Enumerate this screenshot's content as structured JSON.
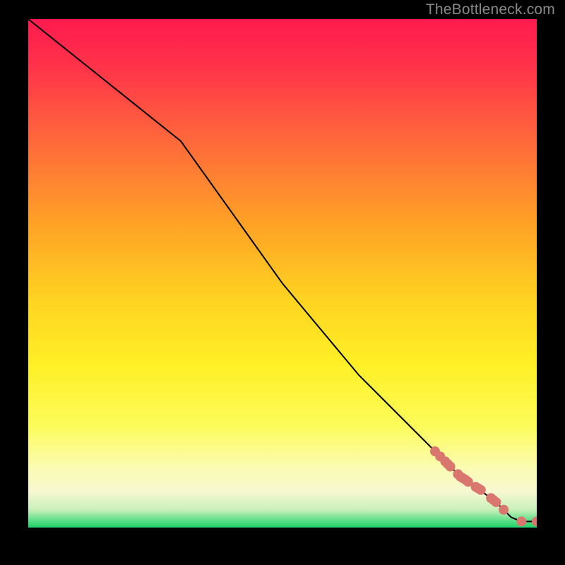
{
  "watermark": "TheBottleneck.com",
  "chart_data": {
    "type": "line",
    "title": "",
    "xlabel": "",
    "ylabel": "",
    "xlim": [
      0,
      100
    ],
    "ylim": [
      0,
      100
    ],
    "line": {
      "x": [
        0,
        5,
        10,
        15,
        20,
        25,
        30,
        35,
        40,
        45,
        50,
        55,
        60,
        65,
        70,
        75,
        80,
        82,
        84,
        86,
        88,
        90,
        92,
        93.5,
        95,
        97,
        100
      ],
      "y": [
        100,
        96,
        92,
        88,
        84,
        80,
        76,
        69,
        62,
        55,
        48,
        42,
        36,
        30,
        25,
        20,
        15,
        13,
        11,
        9.5,
        8,
        6.5,
        5,
        3.5,
        2,
        1.2,
        1.2
      ]
    },
    "markers": {
      "x": [
        80,
        81,
        82,
        82.5,
        83,
        84.5,
        85,
        85.5,
        86,
        86.5,
        88,
        88.5,
        89,
        91,
        91.5,
        92,
        93.5,
        97,
        100
      ],
      "y": [
        15,
        14,
        13,
        12.5,
        12,
        10.5,
        10,
        9.7,
        9.4,
        9,
        8,
        7.7,
        7.4,
        5.8,
        5.4,
        5,
        3.5,
        1.2,
        1.2
      ]
    },
    "gradient_stops": [
      {
        "offset": 0.0,
        "color": "#ff1a4f"
      },
      {
        "offset": 0.1,
        "color": "#ff3549"
      },
      {
        "offset": 0.25,
        "color": "#ff6c3a"
      },
      {
        "offset": 0.4,
        "color": "#ffa126"
      },
      {
        "offset": 0.55,
        "color": "#ffd321"
      },
      {
        "offset": 0.68,
        "color": "#fff026"
      },
      {
        "offset": 0.8,
        "color": "#fcfc5a"
      },
      {
        "offset": 0.88,
        "color": "#fbfbb0"
      },
      {
        "offset": 0.93,
        "color": "#f6f8d2"
      },
      {
        "offset": 0.965,
        "color": "#c9f0b9"
      },
      {
        "offset": 0.985,
        "color": "#62e08a"
      },
      {
        "offset": 1.0,
        "color": "#1fcf6b"
      }
    ],
    "marker_color": "#d9766e",
    "line_color": "#000000"
  }
}
